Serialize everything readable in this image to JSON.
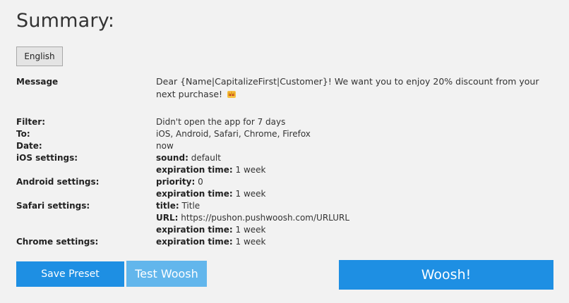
{
  "title": "Summary:",
  "language_button": "English",
  "message": {
    "label": "Message",
    "text": "Dear {Name|CapitalizeFirst|Customer}! We want you to enjoy 20% discount from your next purchase!",
    "emoji_icon": "crown-icon"
  },
  "filter": {
    "label": "Filter:",
    "value": "Didn't open the app for 7 days"
  },
  "to": {
    "label": "To:",
    "value": "iOS, Android, Safari, Chrome, Firefox"
  },
  "date": {
    "label": "Date:",
    "value": "now"
  },
  "ios": {
    "label": "iOS settings:",
    "sound_key": "sound:",
    "sound_value": "default",
    "exp_key": "expiration time:",
    "exp_value": "1 week"
  },
  "android": {
    "label": "Android settings:",
    "priority_key": "priority:",
    "priority_value": "0",
    "exp_key": "expiration time:",
    "exp_value": "1 week"
  },
  "safari": {
    "label": "Safari settings:",
    "title_key": "title:",
    "title_value": "Title",
    "url_key": "URL:",
    "url_value": "https://pushon.pushwoosh.com/URLURL",
    "exp_key": "expiration time:",
    "exp_value": "1 week"
  },
  "chrome": {
    "label": "Chrome settings:",
    "exp_key": "expiration time:",
    "exp_value": "1 week"
  },
  "buttons": {
    "save_preset": "Save Preset",
    "test_woosh": "Test Woosh",
    "woosh": "Woosh!"
  },
  "colors": {
    "primary": "#1e8fe3",
    "secondary": "#62b6ec",
    "background": "#f2f2f2"
  }
}
